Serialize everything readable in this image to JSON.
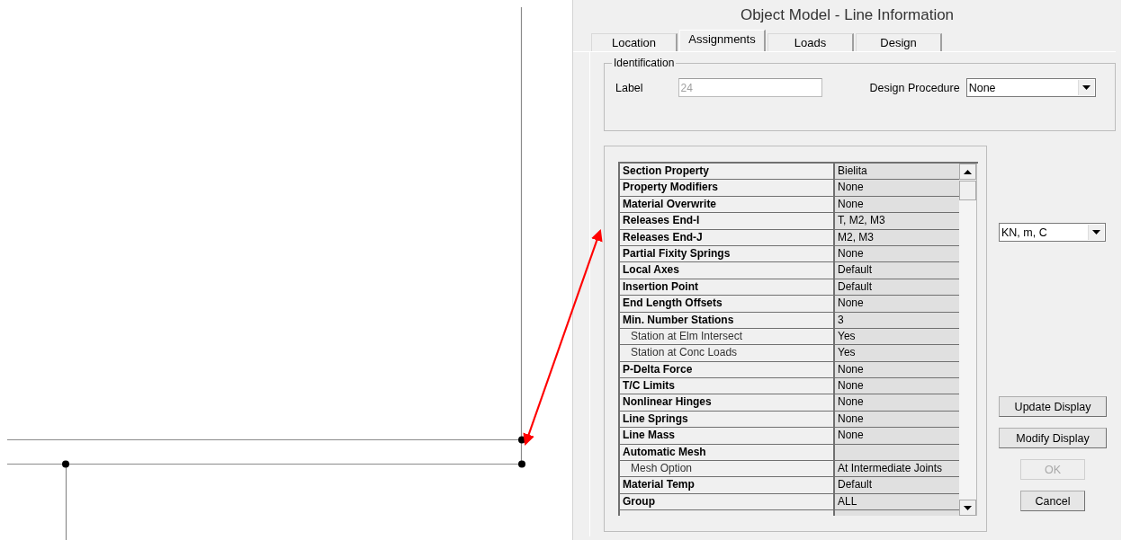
{
  "window": {
    "title": "Object Model - Line Information"
  },
  "tabs": [
    {
      "label": "Location",
      "selected": false
    },
    {
      "label": "Assignments",
      "selected": true
    },
    {
      "label": "Loads",
      "selected": false
    },
    {
      "label": "Design",
      "selected": false
    }
  ],
  "identification": {
    "legend": "Identification",
    "label_caption": "Label",
    "label_value": "24",
    "label_disabled": true,
    "procedure_caption": "Design Procedure",
    "procedure_value": "None"
  },
  "properties": [
    {
      "name": "Section Property",
      "value": "Bielita",
      "kind": "main"
    },
    {
      "name": "Property Modifiers",
      "value": "None",
      "kind": "main"
    },
    {
      "name": "Material Overwrite",
      "value": "None",
      "kind": "main"
    },
    {
      "name": "Releases End-I",
      "value": "T, M2, M3",
      "kind": "main"
    },
    {
      "name": "Releases End-J",
      "value": "M2, M3",
      "kind": "main"
    },
    {
      "name": "Partial Fixity Springs",
      "value": "None",
      "kind": "main"
    },
    {
      "name": "Local Axes",
      "value": "Default",
      "kind": "main"
    },
    {
      "name": "Insertion Point",
      "value": "Default",
      "kind": "main"
    },
    {
      "name": "End Length Offsets",
      "value": "None",
      "kind": "main"
    },
    {
      "name": "Min. Number Stations",
      "value": "3",
      "kind": "main"
    },
    {
      "name": "Station at Elm Intersect",
      "value": "Yes",
      "kind": "sub"
    },
    {
      "name": "Station at Conc Loads",
      "value": "Yes",
      "kind": "sub"
    },
    {
      "name": "P-Delta Force",
      "value": "None",
      "kind": "main"
    },
    {
      "name": "T/C Limits",
      "value": "None",
      "kind": "main"
    },
    {
      "name": "Nonlinear Hinges",
      "value": "None",
      "kind": "main"
    },
    {
      "name": "Line Springs",
      "value": "None",
      "kind": "main"
    },
    {
      "name": "Line Mass",
      "value": "None",
      "kind": "main"
    },
    {
      "name": "Automatic Mesh",
      "kind": "main"
    },
    {
      "name": "Mesh Option",
      "value": "At Intermediate Joints",
      "kind": "sub"
    },
    {
      "name": "Material Temp",
      "value": "Default",
      "kind": "main"
    },
    {
      "name": "Group",
      "value": "ALL",
      "kind": "main"
    }
  ],
  "units": {
    "value": "KN, m, C"
  },
  "buttons": [
    {
      "label": "Update Display",
      "kind": "wide",
      "disabled": false
    },
    {
      "label": "Modify Display",
      "kind": "wide",
      "disabled": false
    },
    {
      "label": "OK",
      "kind": "narrow",
      "disabled": true
    },
    {
      "label": "Cancel",
      "kind": "narrow",
      "disabled": false
    }
  ]
}
